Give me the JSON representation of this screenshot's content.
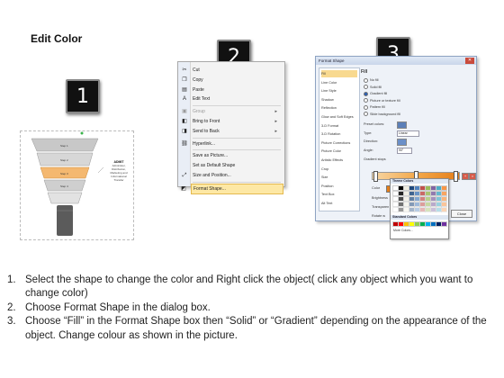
{
  "title": "Edit Color",
  "badges": [
    "1",
    "2",
    "3"
  ],
  "funnel": {
    "steps": [
      "Step 1",
      "Step 2",
      "Step 3",
      "Step 4"
    ],
    "callout_title": "ADMIT",
    "callout_text": [
      "Administer,",
      "Distribution,",
      "Marketing and",
      "Informational",
      "Transfer"
    ],
    "colors": {
      "gray": "#b7b7b7",
      "highlight": "#f4b870",
      "dark": "#555555"
    }
  },
  "context_menu": {
    "items": [
      {
        "label": "Cut",
        "icon": "scissors-icon",
        "glyph": "✂",
        "disabled": false,
        "submenu": false
      },
      {
        "label": "Copy",
        "icon": "copy-icon",
        "glyph": "❐",
        "disabled": false,
        "submenu": false
      },
      {
        "label": "Paste",
        "icon": "paste-icon",
        "glyph": "▤",
        "disabled": false,
        "submenu": false
      },
      {
        "label": "Edit Text",
        "icon": "edit-text-icon",
        "glyph": "A",
        "disabled": false,
        "submenu": false
      },
      {
        "label": "Group",
        "icon": "group-icon",
        "glyph": "▣",
        "disabled": true,
        "submenu": true
      },
      {
        "label": "Bring to Front",
        "icon": "bring-front-icon",
        "glyph": "◧",
        "disabled": false,
        "submenu": true
      },
      {
        "label": "Send to Back",
        "icon": "send-back-icon",
        "glyph": "◨",
        "disabled": false,
        "submenu": true
      },
      {
        "label": "Hyperlink...",
        "icon": "hyperlink-icon",
        "glyph": "⛓",
        "disabled": false,
        "submenu": false
      },
      {
        "label": "Save as Picture...",
        "icon": "",
        "glyph": "",
        "disabled": false,
        "submenu": false
      },
      {
        "label": "Set as Default Shape",
        "icon": "",
        "glyph": "",
        "disabled": false,
        "submenu": false
      },
      {
        "label": "Size and Position...",
        "icon": "size-icon",
        "glyph": "⤢",
        "disabled": false,
        "submenu": false
      },
      {
        "label": "Format Shape...",
        "icon": "format-shape-icon",
        "glyph": "◩",
        "disabled": false,
        "submenu": false
      }
    ],
    "highlight_index": 11
  },
  "dialog": {
    "title": "Format Shape",
    "close_glyph": "✕",
    "nav": [
      "Fill",
      "Line Color",
      "Line Style",
      "Shadow",
      "Reflection",
      "Glow and Soft Edges",
      "3-D Format",
      "3-D Rotation",
      "Picture Corrections",
      "Picture Color",
      "Artistic Effects",
      "Crop",
      "Size",
      "Position",
      "Text Box",
      "Alt Text"
    ],
    "nav_selected": 0,
    "pane_heading": "Fill",
    "fill_options": [
      "No fill",
      "Solid fill",
      "Gradient fill",
      "Picture or texture fill",
      "Pattern fill",
      "Slide background fill"
    ],
    "fill_selected": 2,
    "labels": {
      "preset": "Preset colors:",
      "type": "Type:",
      "type_value": "Linear",
      "direction": "Direction:",
      "angle": "Angle:",
      "angle_value": "90°",
      "stops": "Gradient stops",
      "color": "Color",
      "position": "Position:",
      "position_value": "0%",
      "brightness": "Brightness",
      "transparency": "Transparen",
      "rotate": "Rotate w",
      "close": "Close"
    },
    "palette": {
      "theme_header": "Theme Colors",
      "standard_header": "Standard Colors",
      "more": "More Colors...",
      "theme_colors": [
        "#ffffff",
        "#000000",
        "#eeece1",
        "#1f497d",
        "#4f81bd",
        "#c0504d",
        "#9bbb59",
        "#8064a2",
        "#4bacc6",
        "#f79646"
      ],
      "standard_colors": [
        "#c00000",
        "#ff0000",
        "#ffc000",
        "#ffff00",
        "#92d050",
        "#00b050",
        "#00b0f0",
        "#0070c0",
        "#002060",
        "#7030a0"
      ]
    }
  },
  "instructions": [
    {
      "num": "1.",
      "text": "Select the shape to change the color and Right click the object( click any object which you want to change color)"
    },
    {
      "num": "2.",
      "text": "Choose Format Shape in the dialog box."
    },
    {
      "num": "3.",
      "text": "Choose “Fill” in the Format Shape box then “Solid” or “Gradient” depending on the appearance of the object. Change colour as shown in the picture."
    }
  ]
}
